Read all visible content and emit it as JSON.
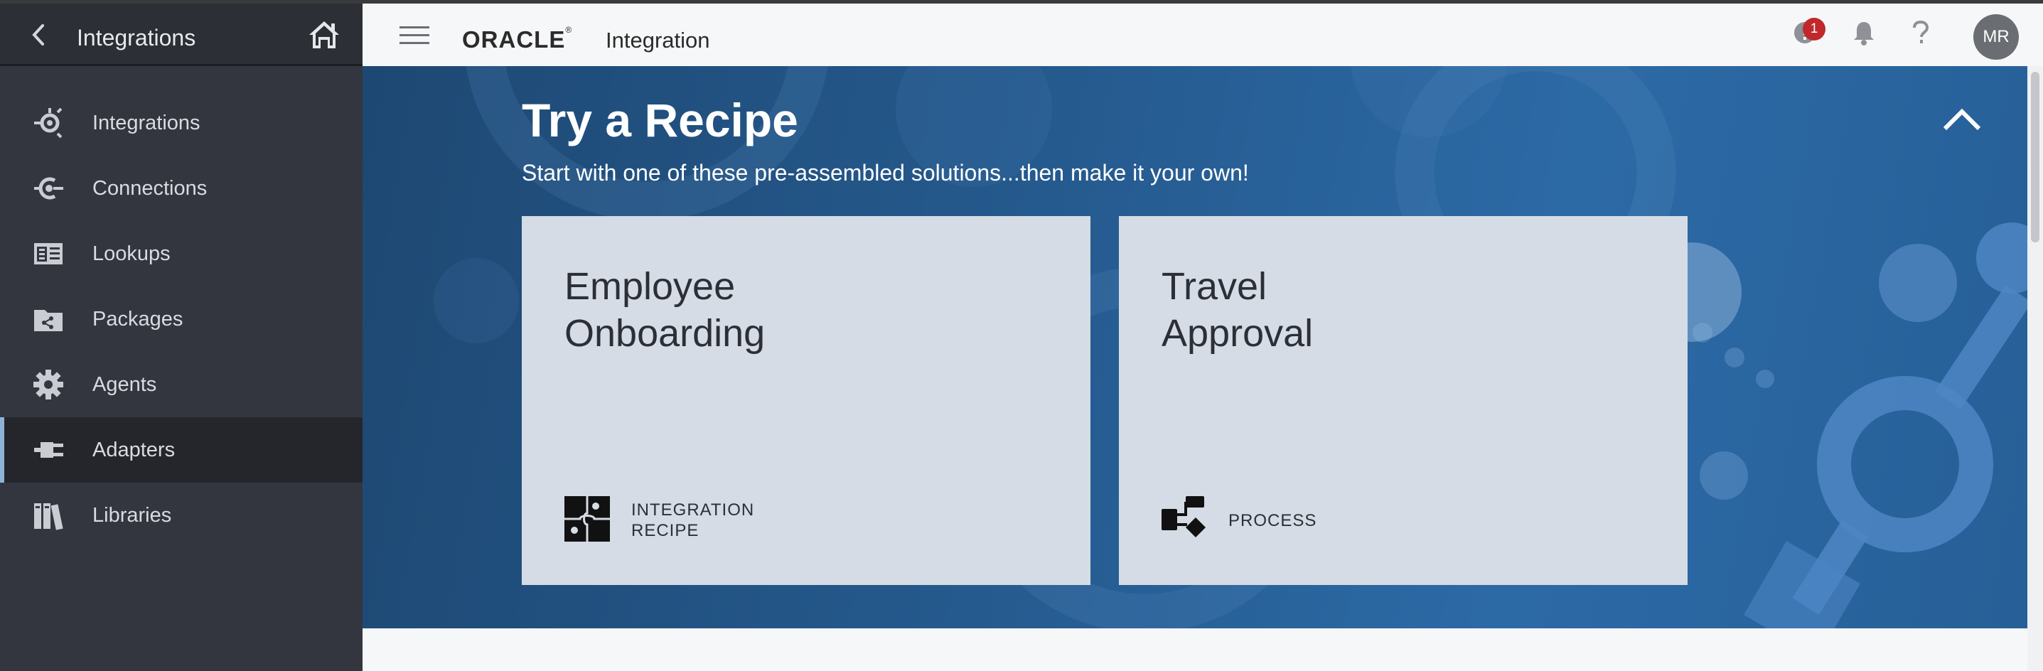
{
  "sidebar": {
    "title": "Integrations",
    "items": [
      {
        "label": "Integrations",
        "icon": "integrations-icon"
      },
      {
        "label": "Connections",
        "icon": "connections-icon"
      },
      {
        "label": "Lookups",
        "icon": "lookups-icon"
      },
      {
        "label": "Packages",
        "icon": "packages-icon"
      },
      {
        "label": "Agents",
        "icon": "gear-icon"
      },
      {
        "label": "Adapters",
        "icon": "plug-icon",
        "active": true
      },
      {
        "label": "Libraries",
        "icon": "books-icon"
      }
    ]
  },
  "header": {
    "brand": "ORACLE",
    "brand_mark": "®",
    "app_name": "Integration",
    "notification_count": "1",
    "avatar_initials": "MR"
  },
  "banner": {
    "title": "Try a Recipe",
    "subtitle": "Start with one of these pre-assembled solutions...then make it your own!",
    "cards": [
      {
        "title": "Employee\nOnboarding",
        "type": "INTEGRATION\nRECIPE",
        "icon": "puzzle-icon"
      },
      {
        "title": "Travel\nApproval",
        "type": "PROCESS",
        "icon": "process-flow-icon"
      }
    ]
  },
  "colors": {
    "sidebar_bg": "#34363f",
    "banner_blue": "#255a8e",
    "card_bg": "#d5dce5",
    "badge_red": "#c0282b",
    "active_indicator": "#8fb3d8"
  }
}
